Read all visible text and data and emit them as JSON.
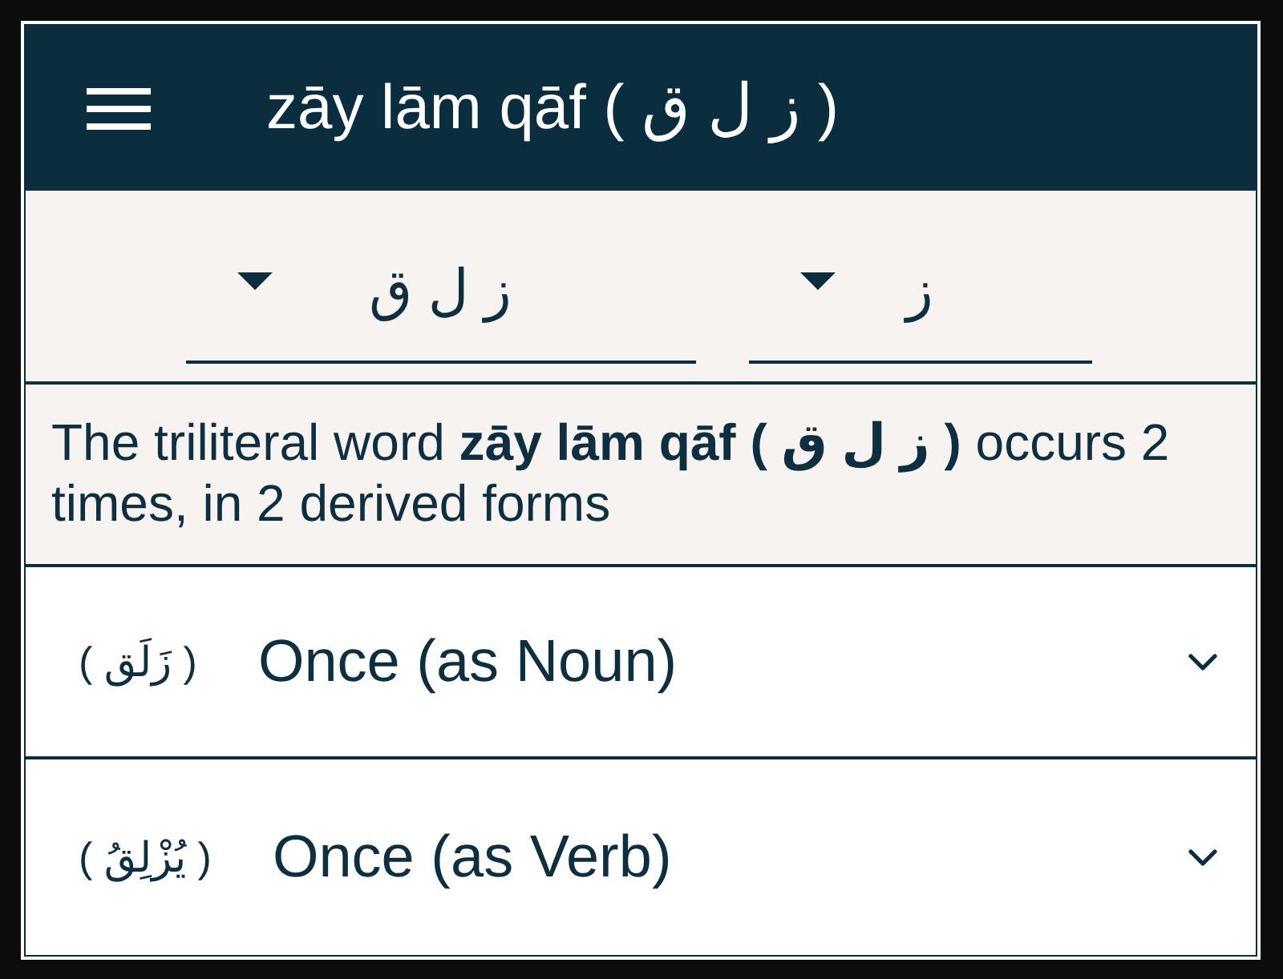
{
  "app_bar": {
    "title": "zāy lām qāf ( ز ل ق )"
  },
  "root_dropdown": {
    "value": "ز ل ق"
  },
  "letter_dropdown": {
    "value": "ز"
  },
  "summary": {
    "text": "The triliteral word **zāy lām qāf ( ز ل ق )** occurs 2 times, in 2 derived forms"
  },
  "forms": [
    {
      "arabic": "( زَلَق )",
      "label": "Once (as Noun)",
      "expanded": false
    },
    {
      "arabic": "( يُزْلِقُ )",
      "label": "Once (as Verb)",
      "expanded": false
    }
  ]
}
